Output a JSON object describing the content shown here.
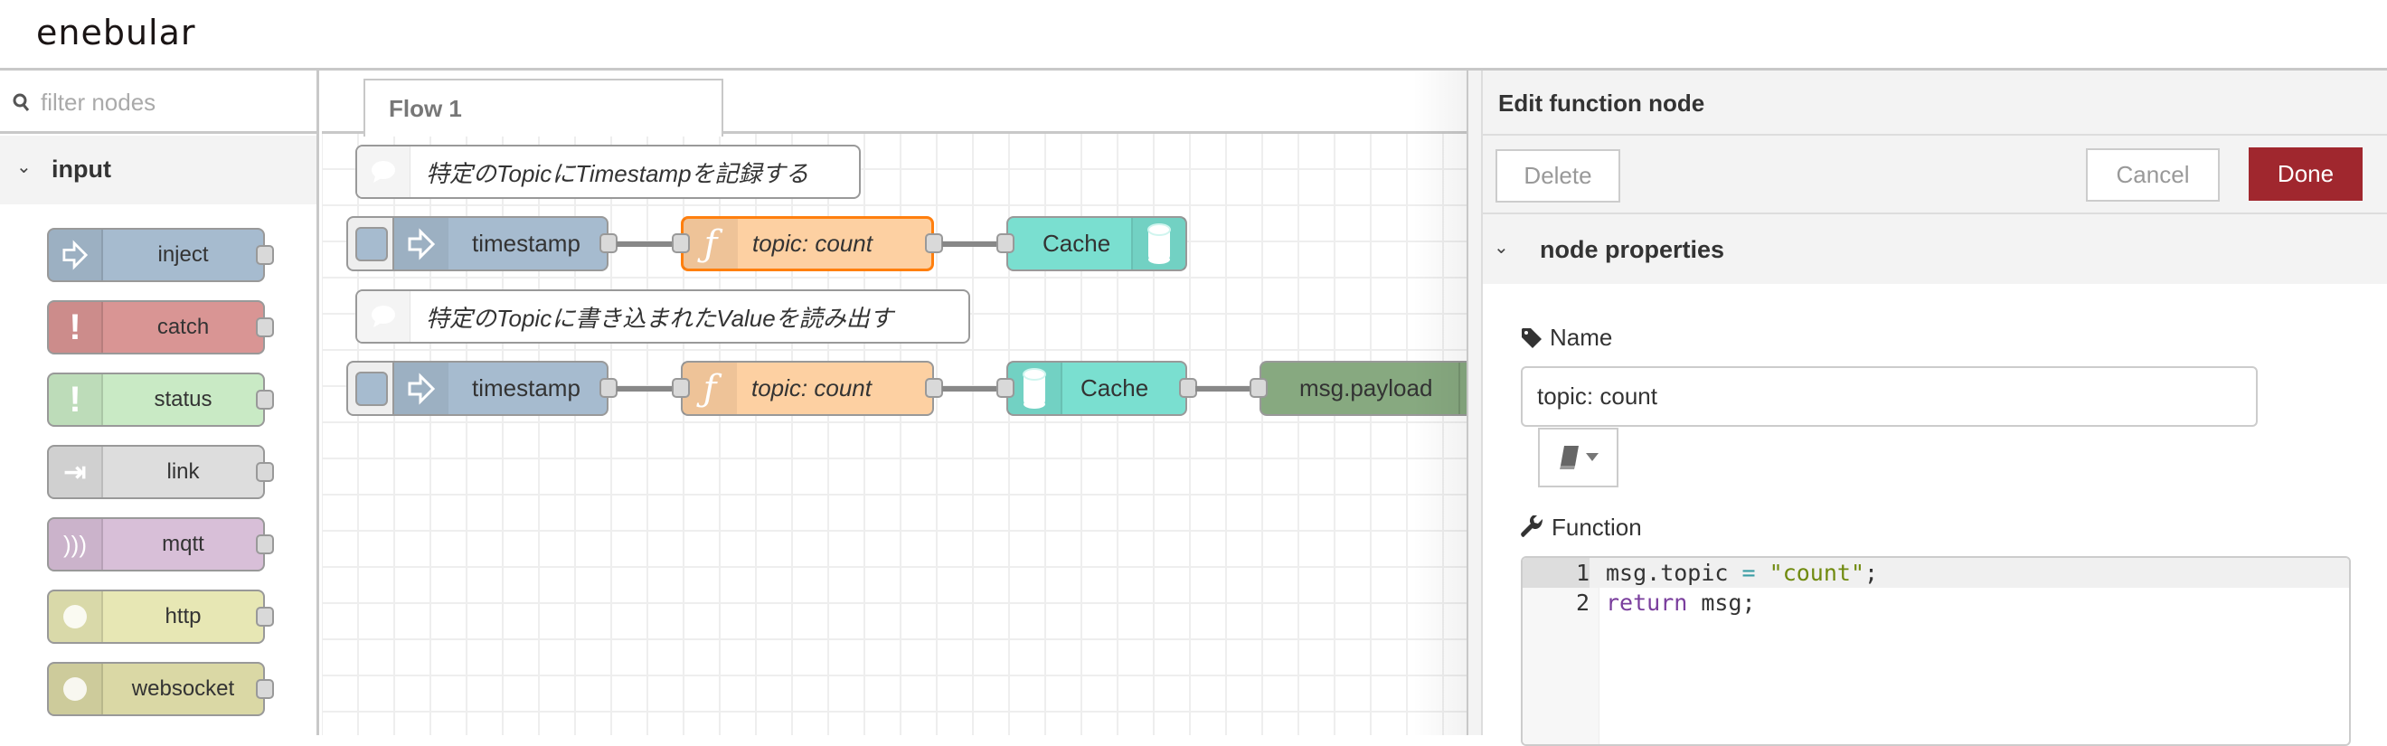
{
  "header": {
    "logo": "enebular"
  },
  "sidebar": {
    "filter_placeholder": "filter nodes",
    "category": "input",
    "nodes": [
      {
        "label": "inject",
        "color": "#a6bbcf",
        "icon": "arrow-right-icon"
      },
      {
        "label": "catch",
        "color": "#d99594",
        "icon": "exclamation-icon"
      },
      {
        "label": "status",
        "color": "#c9eac5",
        "icon": "exclamation-icon"
      },
      {
        "label": "link",
        "color": "#dddddd",
        "icon": "link-icon"
      },
      {
        "label": "mqtt",
        "color": "#d8bfd8",
        "icon": "wifi-icon"
      },
      {
        "label": "http",
        "color": "#e7e7b4",
        "icon": "globe-icon"
      },
      {
        "label": "websocket",
        "color": "#dad8a5",
        "icon": "globe-icon"
      }
    ]
  },
  "canvas": {
    "tab": "Flow 1",
    "comments": [
      "特定のTopicにTimestampを記録する",
      "特定のTopicに書き込まれたValueを読み出す"
    ],
    "flow1": {
      "inject": "timestamp",
      "function": "topic: count",
      "cache": "Cache"
    },
    "flow2": {
      "inject": "timestamp",
      "function": "topic: count",
      "cache": "Cache",
      "debug": "msg.payload"
    },
    "colors": {
      "inject": "#a6bbcf",
      "function": "#fdd0a2",
      "cache": "#7adfd0",
      "debug": "#87a980",
      "selected": "#ff7f0e"
    }
  },
  "editor": {
    "title": "Edit function node",
    "delete": "Delete",
    "cancel": "Cancel",
    "done": "Done",
    "done_color": "#a0272e",
    "section": "node properties",
    "name_label": "Name",
    "name_value": "topic: count",
    "function_label": "Function",
    "code": [
      {
        "num": "1",
        "parts": [
          [
            "",
            "msg.topic "
          ],
          [
            "op",
            "="
          ],
          [
            "",
            " "
          ],
          [
            "str",
            "\"count\""
          ],
          [
            "",
            ";"
          ]
        ]
      },
      {
        "num": "2",
        "parts": [
          [
            "kw",
            "return"
          ],
          [
            "",
            " msg;"
          ]
        ]
      }
    ]
  }
}
